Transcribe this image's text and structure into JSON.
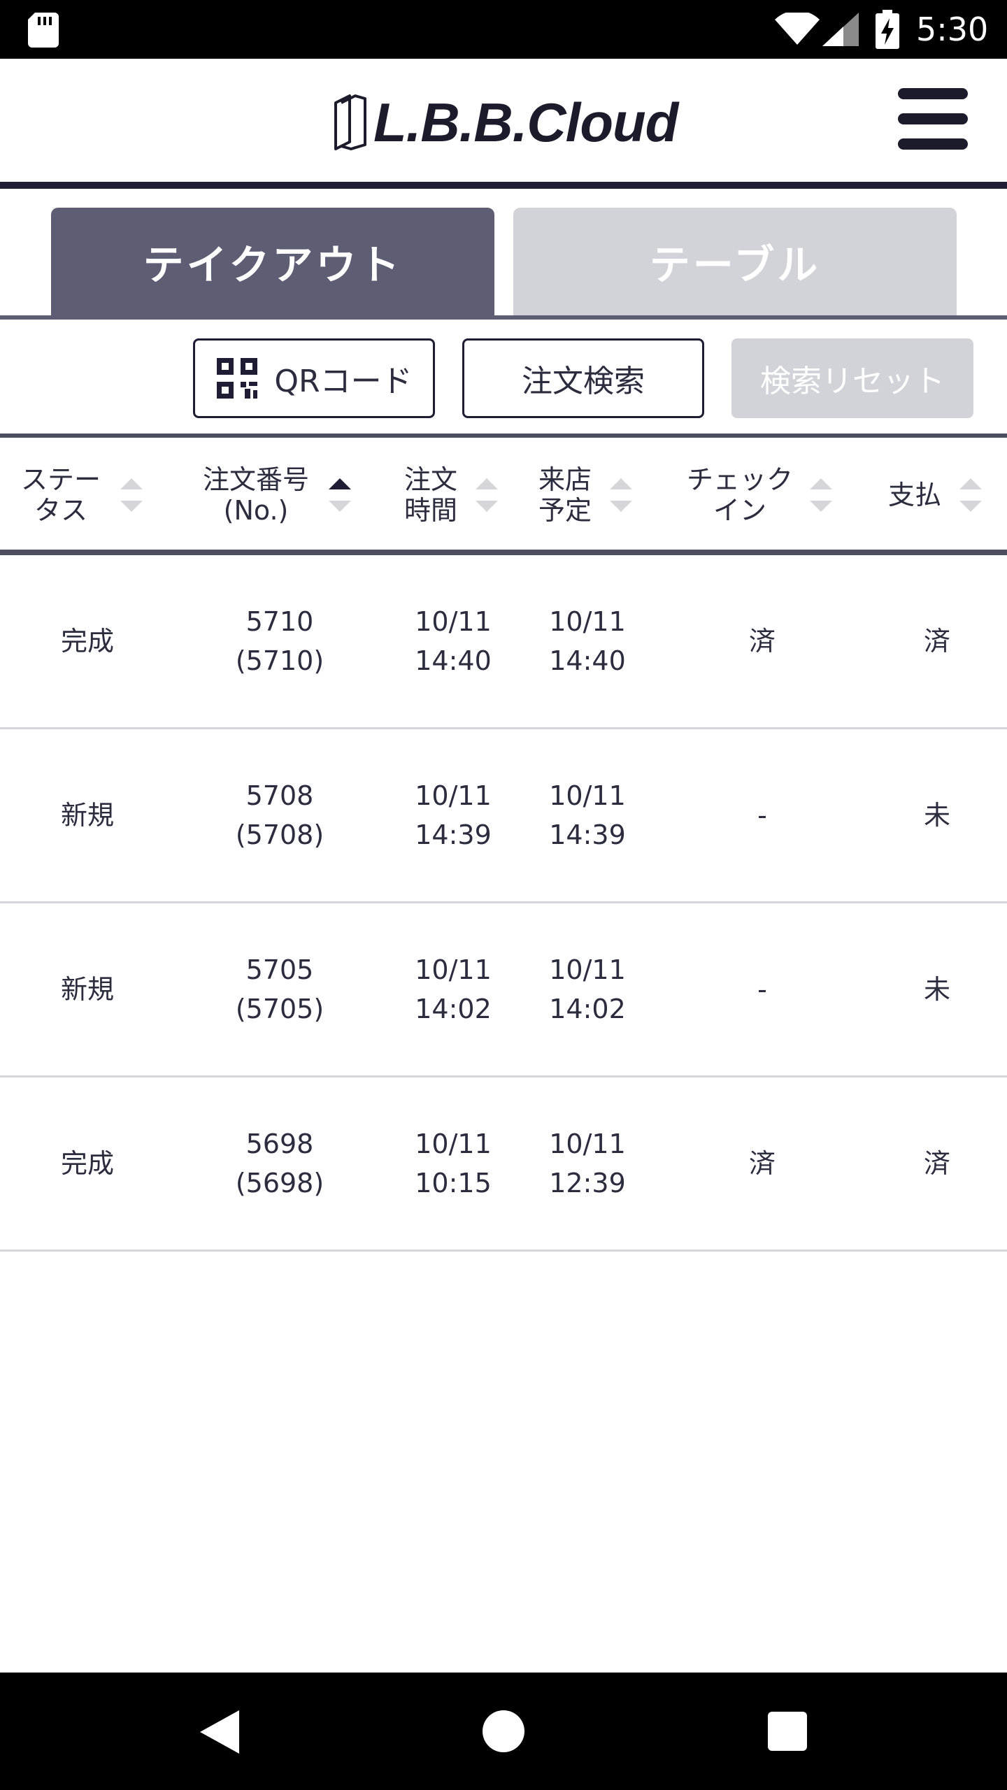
{
  "status_bar": {
    "time": "5:30"
  },
  "header": {
    "logo_text": "L.B.B.Cloud"
  },
  "tabs": [
    {
      "label": "テイクアウト",
      "active": true
    },
    {
      "label": "テーブル",
      "active": false
    }
  ],
  "actions": {
    "qr_label": "QRコード",
    "search_label": "注文検索",
    "reset_label": "検索リセット",
    "reset_disabled": true
  },
  "table": {
    "columns": [
      {
        "label": "ステー\nタス",
        "sort": "none"
      },
      {
        "label": "注文番号\n(No.)",
        "sort": "ascending"
      },
      {
        "label": "注文\n時間",
        "sort": "none"
      },
      {
        "label": "来店\n予定",
        "sort": "none"
      },
      {
        "label": "チェック\nイン",
        "sort": "none"
      },
      {
        "label": "支払",
        "sort": "none"
      }
    ],
    "rows": [
      {
        "status": "完成",
        "order_no": "5710\n(5710)",
        "order_time": "10/11\n14:40",
        "visit_time": "10/11\n14:40",
        "checkin": "済",
        "payment": "済"
      },
      {
        "status": "新規",
        "order_no": "5708\n(5708)",
        "order_time": "10/11\n14:39",
        "visit_time": "10/11\n14:39",
        "checkin": "-",
        "payment": "未"
      },
      {
        "status": "新規",
        "order_no": "5705\n(5705)",
        "order_time": "10/11\n14:02",
        "visit_time": "10/11\n14:02",
        "checkin": "-",
        "payment": "未"
      },
      {
        "status": "完成",
        "order_no": "5698\n(5698)",
        "order_time": "10/11\n10:15",
        "visit_time": "10/11\n12:39",
        "checkin": "済",
        "payment": "済"
      }
    ]
  },
  "colors": {
    "brand_dark": "#1e1d33",
    "tab_active": "#5d5d74",
    "tab_inactive": "#d2d3d8",
    "text": "#2b2d3f"
  }
}
